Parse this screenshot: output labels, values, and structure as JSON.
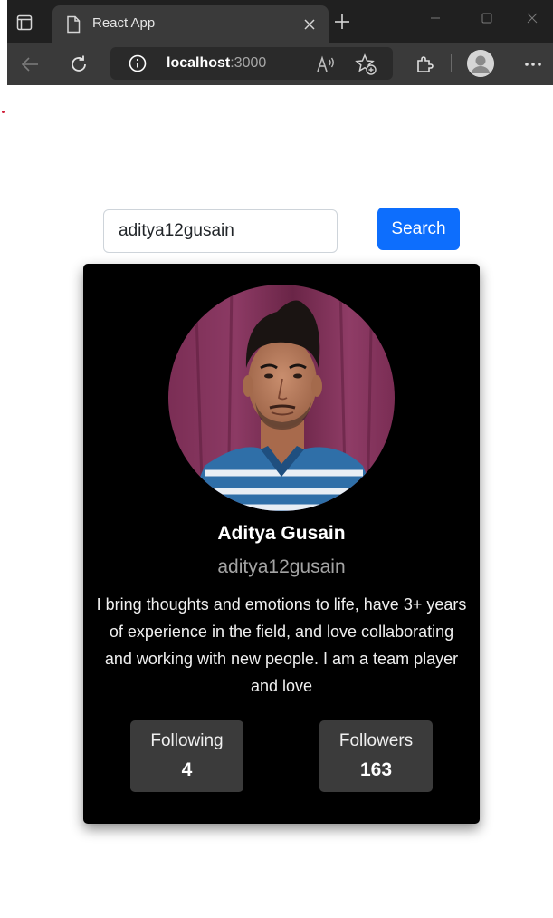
{
  "browser": {
    "tab_title": "React App",
    "address_host": "localhost",
    "address_port": ":3000"
  },
  "search": {
    "input_value": "aditya12gusain",
    "button_label": "Search"
  },
  "profile": {
    "name": "Aditya Gusain",
    "username": "aditya12gusain",
    "bio": "I bring thoughts and emotions to life, have 3+ years of experience in the field, and love collaborating and working with new people. I am a team player and love",
    "following_label": "Following",
    "following_count": "4",
    "followers_label": "Followers",
    "followers_count": "163"
  },
  "colors": {
    "primary": "#0d6efd",
    "card_bg": "#000000",
    "stat_bg": "#3b3b3b"
  }
}
